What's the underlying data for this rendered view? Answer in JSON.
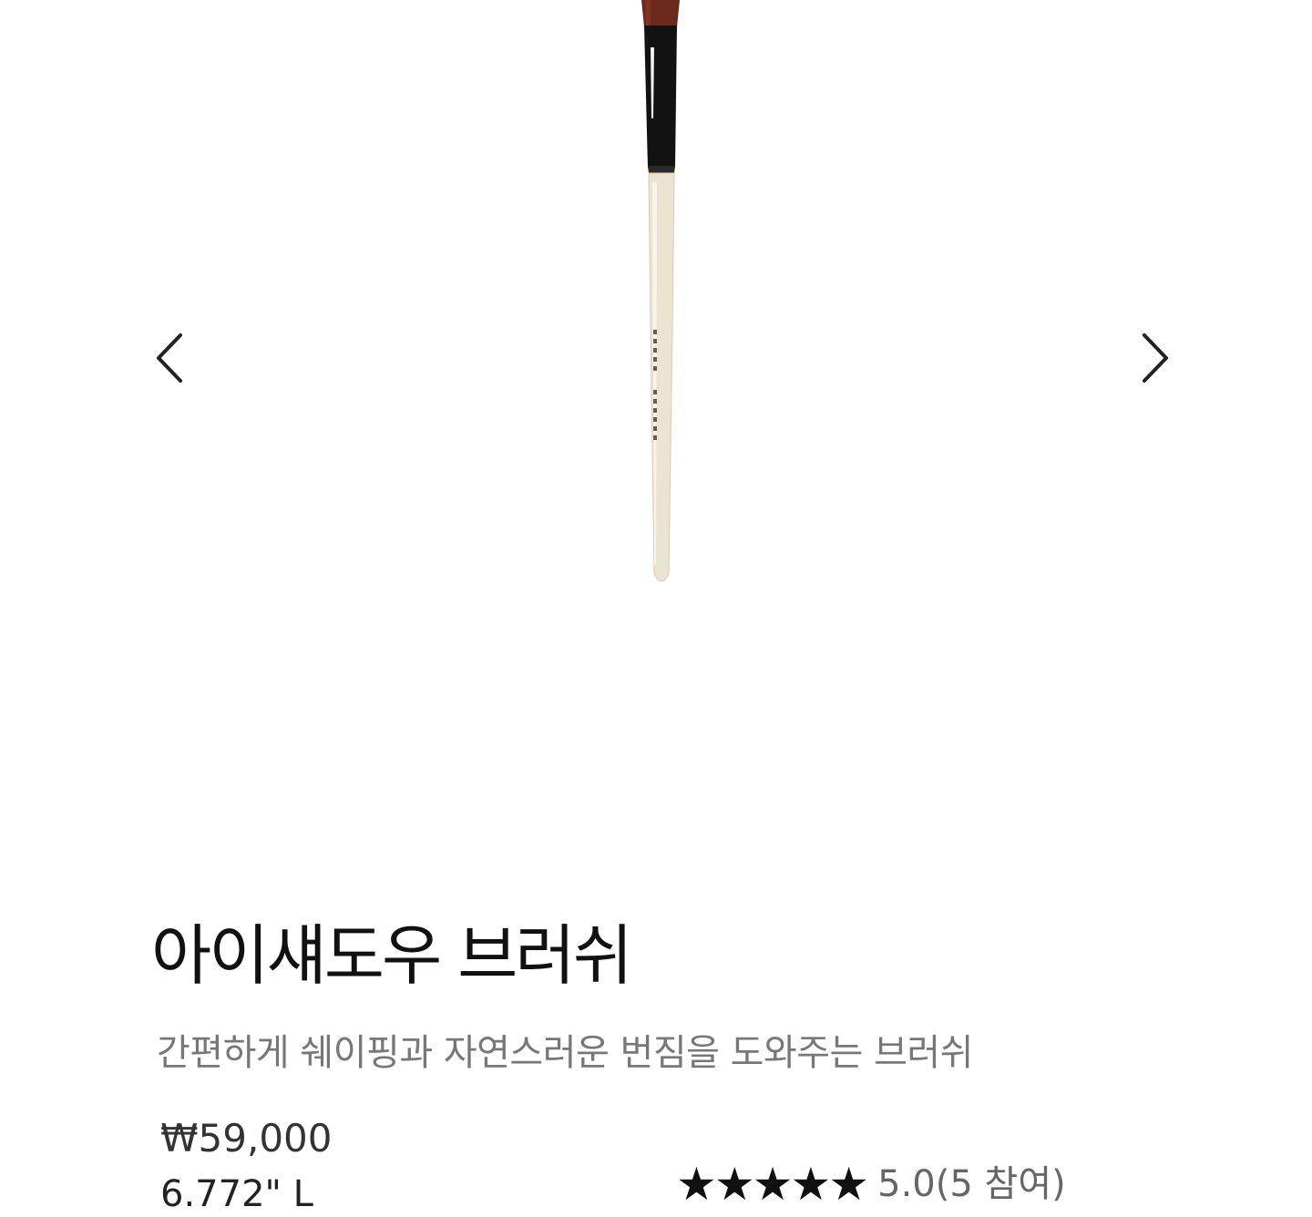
{
  "carousel": {
    "prev_icon": "chevron-left-icon",
    "next_icon": "chevron-right-icon",
    "image_subject": "eyeshadow-brush",
    "brush_colors": {
      "bristles": "#6b2a1c",
      "ferrule": "#121212",
      "handle": "#ece4d2"
    }
  },
  "product": {
    "title": "아이섀도우 브러쉬",
    "subtitle": "간편하게 쉐이핑과 자연스러운 번짐을 도와주는 브러쉬",
    "price": "₩59,000",
    "size": "6.772\" L"
  },
  "rating": {
    "stars": "★★★★★",
    "value": 5.0,
    "score": "5.0",
    "count": "(5 참여)",
    "star_color": "#111111"
  }
}
